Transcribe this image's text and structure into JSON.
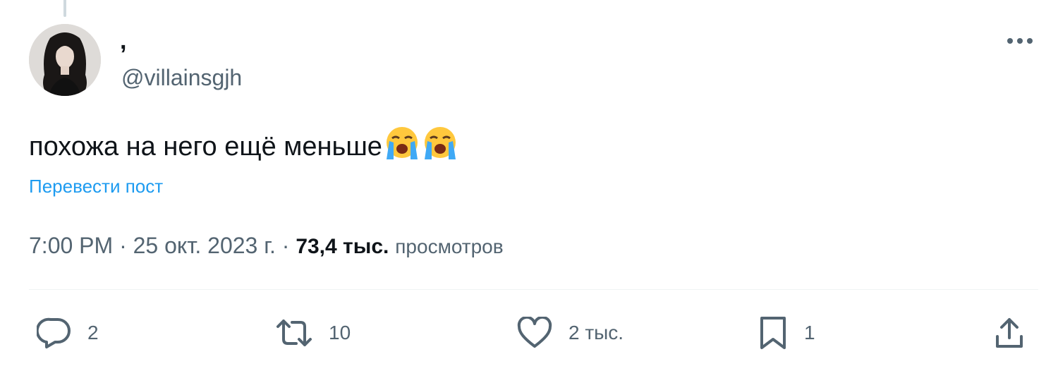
{
  "tweet": {
    "display_name": ",",
    "username": "@villainsgjh",
    "text": "похожа на него ещё меньше",
    "emojis": [
      "loudly-crying-face",
      "loudly-crying-face"
    ],
    "translate_label": "Перевести пост",
    "time": "7:00 PM",
    "date": "25 окт. 2023 г.",
    "separator": "·",
    "views_count": "73,4 тыс.",
    "views_label": "просмотров"
  },
  "actions": {
    "replies": "2",
    "reposts": "10",
    "likes": "2 тыс.",
    "bookmarks": "1"
  },
  "colors": {
    "text_primary": "#0f1419",
    "text_secondary": "#536471",
    "link": "#1d9bf0",
    "divider": "#eff3f4"
  },
  "icons": [
    "more-icon",
    "reply-icon",
    "repost-icon",
    "like-icon",
    "bookmark-icon",
    "share-icon"
  ]
}
